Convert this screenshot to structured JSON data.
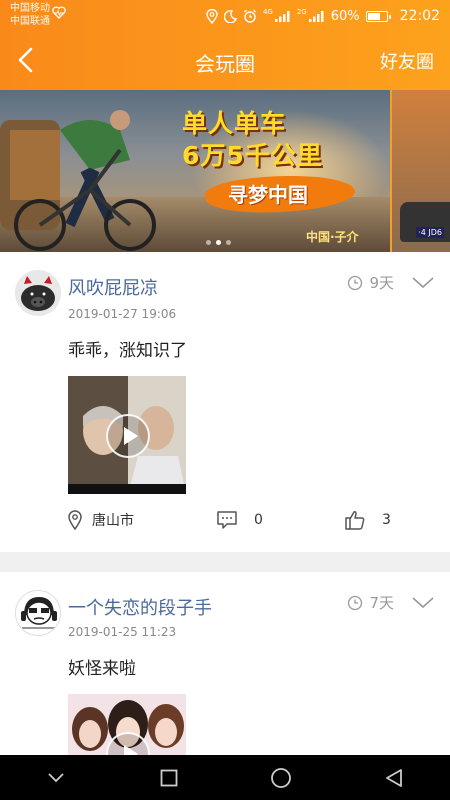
{
  "status_bar": {
    "carrier1": "中国移动",
    "carrier2": "中国联通",
    "network1": "4G",
    "network2": "2G",
    "battery": "60%",
    "time": "22:02"
  },
  "header": {
    "title": "会玩圈",
    "right_link": "好友圈"
  },
  "banner": {
    "headline1": "单人单车",
    "headline2": "6万5千公里",
    "tagline": "寻梦中国",
    "footer": "中国·子介",
    "plate": "·4 JD6",
    "dots": 3,
    "active_dot": 1
  },
  "posts": [
    {
      "username": "风吹屁屁凉",
      "age": "9天",
      "date": "2019-01-27 19:06",
      "text": "乖乖，涨知识了",
      "location": "唐山市",
      "comments": "0",
      "likes": "3"
    },
    {
      "username": "一个失恋的段子手",
      "age": "7天",
      "date": "2019-01-25 11:23",
      "text": "妖怪来啦"
    }
  ],
  "colors": {
    "accent": "#f98a1a",
    "username": "#4b6a9c"
  }
}
